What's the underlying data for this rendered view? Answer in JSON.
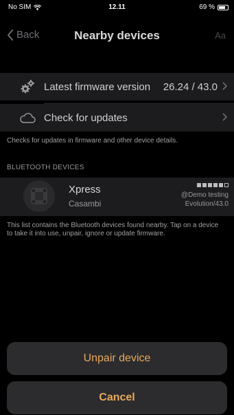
{
  "status_bar": {
    "carrier": "No SIM",
    "time": "12.11",
    "battery": "69 %"
  },
  "navbar": {
    "back_label": "Back",
    "title": "Nearby devices",
    "text_size_label": "Aa"
  },
  "firmware_row": {
    "label": "Latest firmware version",
    "value": "26.24 / 43.0",
    "icon": "gears-icon"
  },
  "updates_row": {
    "label": "Check for updates",
    "icon": "cloud-icon"
  },
  "updates_footnote": "Checks for updates in firmware and other device details.",
  "section_header": "BLUETOOTH DEVICES",
  "device": {
    "name": "Xpress",
    "vendor": "Casambi",
    "network": "@Demo testing",
    "version": "Evolution/43.0",
    "signal_bars": 5,
    "signal_filled": 4
  },
  "list_footnote": "This list contains the Bluetooth devices found nearby. Tap on a device to take it into use, unpair, ignore or update firmware.",
  "action_sheet": {
    "unpair_label": "Unpair device",
    "cancel_label": "Cancel"
  },
  "colors": {
    "accent": "#e8a95b",
    "background": "#000000",
    "cell": "#1c1c1e"
  }
}
